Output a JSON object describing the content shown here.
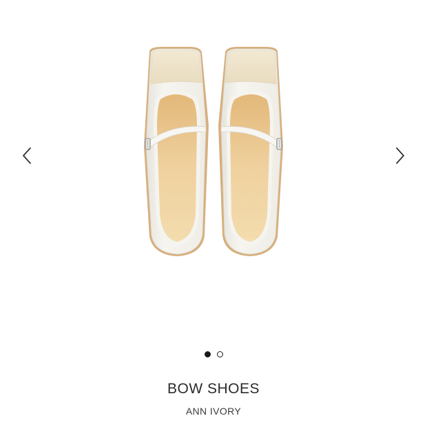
{
  "carousel": {
    "image_alt": "Pair of ivory square-toe Mary Jane flats with buckled ankle straps, viewed from above",
    "prev_icon": "chevron-left-icon",
    "next_icon": "chevron-right-icon",
    "slide_count": 2,
    "active_slide": 1
  },
  "product": {
    "title": "BOW SHOES",
    "color": "ANN IVORY"
  },
  "colors": {
    "shoe_leather": "#f1efe8",
    "toe_cap": "#ede3cc",
    "insole": "#e8c78f",
    "welt": "#d4a977",
    "dot_active": "#1a1a1a"
  }
}
